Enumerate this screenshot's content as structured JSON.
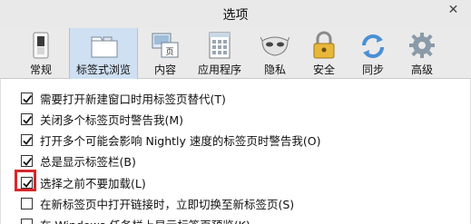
{
  "window": {
    "title": "选项",
    "close_glyph": "✕"
  },
  "toolbar": {
    "items": [
      {
        "label": "常规",
        "icon": "switch-icon"
      },
      {
        "label": "标签式浏览",
        "icon": "tabs-icon",
        "selected": true
      },
      {
        "label": "内容",
        "icon": "content-icon"
      },
      {
        "label": "应用程序",
        "icon": "applications-icon"
      },
      {
        "label": "隐私",
        "icon": "mask-icon"
      },
      {
        "label": "安全",
        "icon": "lock-icon"
      },
      {
        "label": "同步",
        "icon": "sync-icon"
      },
      {
        "label": "高级",
        "icon": "gear-icon"
      }
    ]
  },
  "options": [
    {
      "label": "需要打开新建窗口时用标签页替代(T)",
      "checked": true
    },
    {
      "label": "关闭多个标签页时警告我(M)",
      "checked": true
    },
    {
      "label": "打开多个可能会影响 Nightly 速度的标签页时警告我(O)",
      "checked": true
    },
    {
      "label": "总是显示标签栏(B)",
      "checked": true
    },
    {
      "label": "选择之前不要加载(L)",
      "checked": true
    },
    {
      "label": "在新标签页中打开链接时，立即切换至新标签页(S)",
      "checked": false
    },
    {
      "label": "在 Windows 任务栏上显示标签页预览(K)",
      "checked": false
    }
  ],
  "colors": {
    "selected_tab": "#cfe0f2",
    "highlight": "#d9262b"
  }
}
